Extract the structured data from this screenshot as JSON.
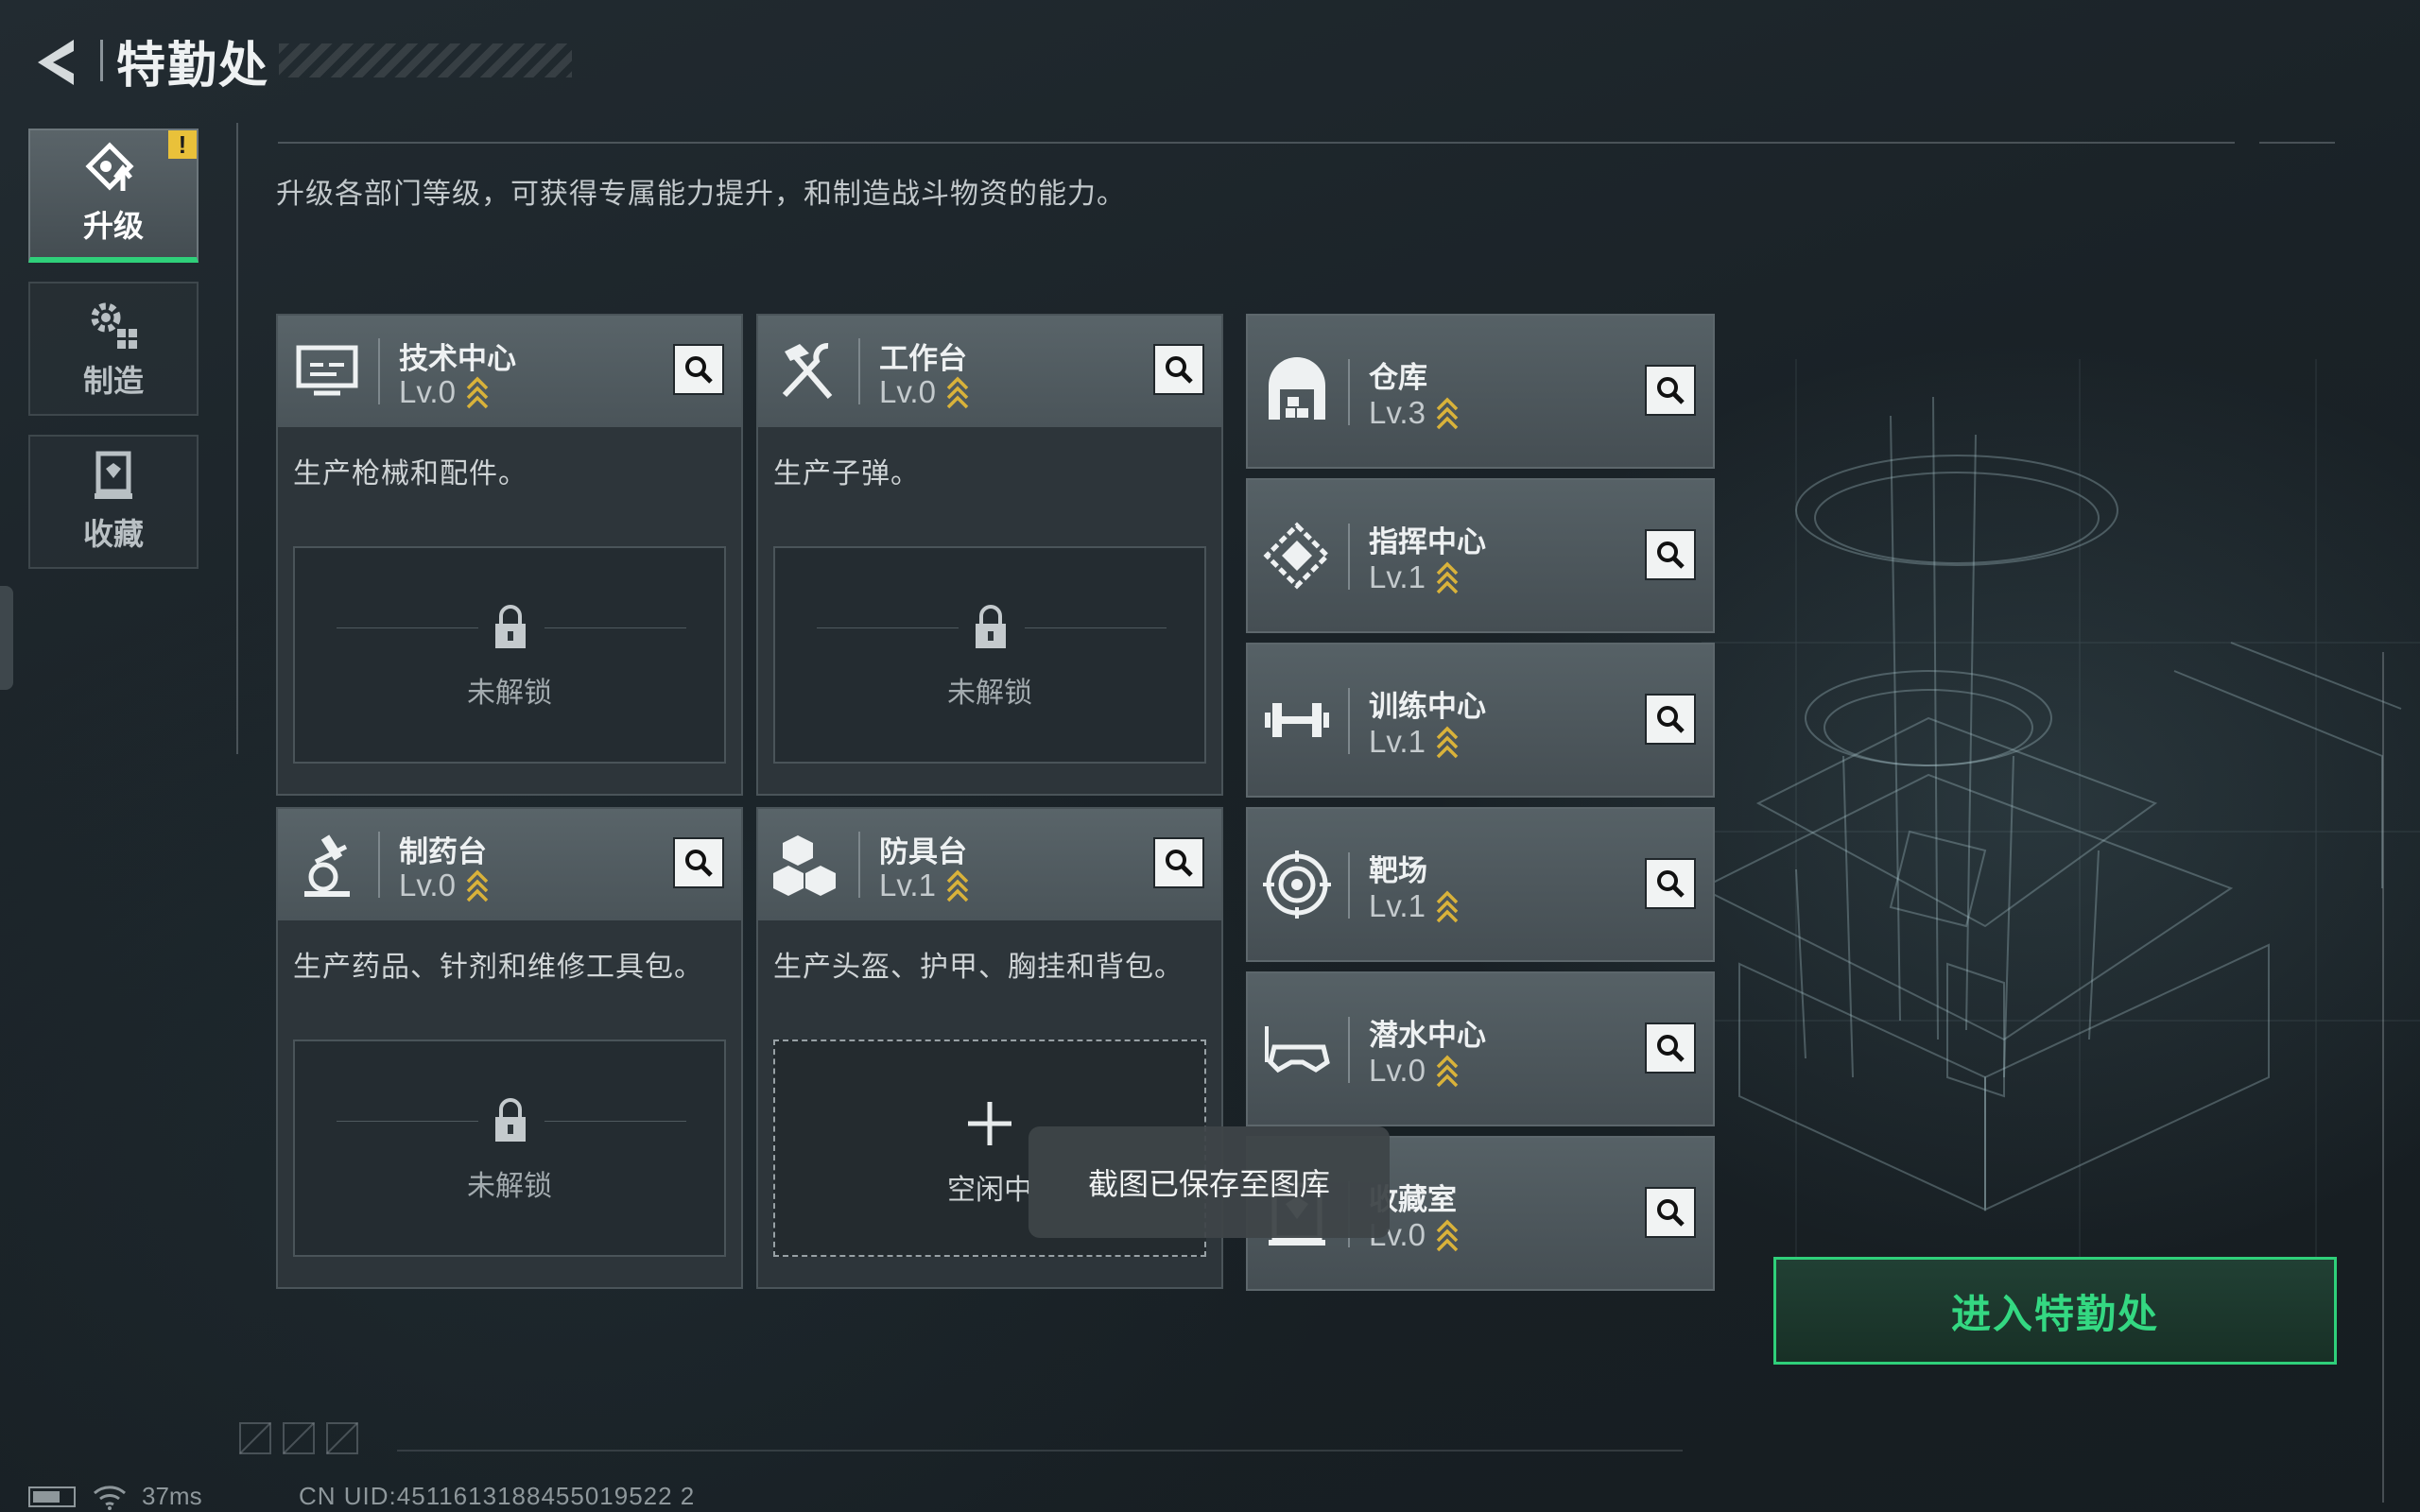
{
  "header": {
    "title": "特勤处",
    "back_icon": "back-arrow-icon"
  },
  "nav": {
    "items": [
      {
        "label": "升级",
        "icon": "upgrade-icon",
        "active": true,
        "badge": "!"
      },
      {
        "label": "制造",
        "icon": "gears-icon",
        "active": false
      },
      {
        "label": "收藏",
        "icon": "collection-icon",
        "active": false
      }
    ]
  },
  "subtitle": "升级各部门等级，可获得专属能力提升，和制造战斗物资的能力。",
  "departments": [
    {
      "name": "技术中心",
      "level": "Lv.0",
      "icon": "monitor-icon",
      "desc": "生产枪械和配件。",
      "slot": "未解锁"
    },
    {
      "name": "工作台",
      "level": "Lv.0",
      "icon": "tools-icon",
      "desc": "生产子弹。",
      "slot": "未解锁"
    },
    {
      "name": "制药台",
      "level": "Lv.0",
      "icon": "microscope-icon",
      "desc": "生产药品、针剂和维修工具包。",
      "slot": "未解锁"
    },
    {
      "name": "防具台",
      "level": "Lv.1",
      "icon": "cubes-icon",
      "desc": "生产头盔、护甲、胸挂和背包。",
      "slot": "空闲中"
    }
  ],
  "facilities": [
    {
      "name": "仓库",
      "level": "Lv.3",
      "icon": "warehouse-icon"
    },
    {
      "name": "指挥中心",
      "level": "Lv.1",
      "icon": "command-chip-icon"
    },
    {
      "name": "训练中心",
      "level": "Lv.1",
      "icon": "dumbbell-icon"
    },
    {
      "name": "靶场",
      "level": "Lv.1",
      "icon": "target-icon"
    },
    {
      "name": "潜水中心",
      "level": "Lv.0",
      "icon": "diving-mask-icon"
    },
    {
      "name": "收藏室",
      "level": "Lv.0",
      "icon": "collection-room-icon"
    }
  ],
  "enter_button": "进入特勤处",
  "toast": "截图已保存至图库",
  "status": {
    "ping": "37ms",
    "uid": "CN UID:4511613188455019522 2"
  },
  "colors": {
    "accent": "#2fd07a",
    "badge": "#e9c13a",
    "level_up": "#d9b23a"
  }
}
